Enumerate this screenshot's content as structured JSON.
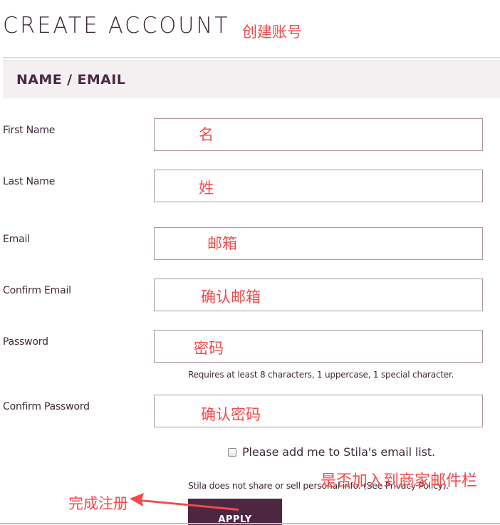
{
  "page": {
    "title": "CREATE ACCOUNT",
    "title_annotation": "创建账号"
  },
  "section": {
    "title": "NAME / EMAIL"
  },
  "fields": [
    {
      "label": "First Name",
      "value": "名"
    },
    {
      "label": "Last Name",
      "value": "姓"
    },
    {
      "label": "Email",
      "value": "邮箱"
    },
    {
      "label": "Confirm Email",
      "value": "确认邮箱"
    },
    {
      "label": "Password",
      "value": "密码"
    },
    {
      "label": "Confirm Password",
      "value": "确认密码"
    }
  ],
  "password_hint": "Requires at least 8 characters, 1 uppercase, 1 special character.",
  "newsletter": {
    "label": "Please add me to Stila's email list.",
    "checked": false,
    "annotation": "是否加入到商家邮件栏"
  },
  "privacy_note": "Stila does not share or sell personal info. (See Privacy Policy).",
  "submit": {
    "label": "APPLY",
    "annotation": "完成注册"
  },
  "colors": {
    "brand": "#4d2741",
    "annotation": "#f24a4a",
    "header_bg": "#f4f0f1",
    "input_border": "#a993a4"
  }
}
